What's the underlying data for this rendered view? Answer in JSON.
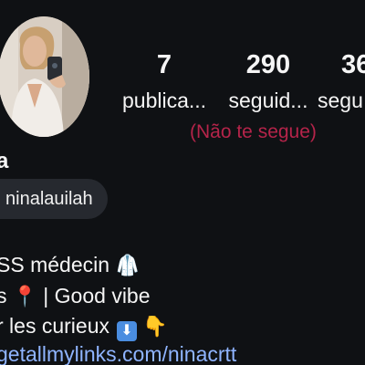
{
  "profile": {
    "display_name_visible": "a",
    "username_visible": "ninalauilah",
    "follow_note": "(Não te segue)"
  },
  "stats": {
    "posts": {
      "count": "7",
      "label": "publica..."
    },
    "followers": {
      "count": "290",
      "label": "seguid..."
    },
    "following": {
      "count": "36",
      "label": "segu"
    }
  },
  "bio": {
    "line1": "SS médecin",
    "line1_icon": "lab-coat-icon",
    "line2_prefix": "s",
    "line2_suffix": "| Good vibe",
    "line2_icon": "pin-icon",
    "line3": "r les curieux",
    "line3_icons": [
      "down-arrow-icon",
      "pointing-down-hand-icon"
    ],
    "link": "getallmylinks.com/ninacrtt"
  },
  "colors": {
    "background": "#0f1114",
    "follow_note": "#b5244a",
    "link": "#8fb4ff",
    "pill": "#26292f"
  }
}
